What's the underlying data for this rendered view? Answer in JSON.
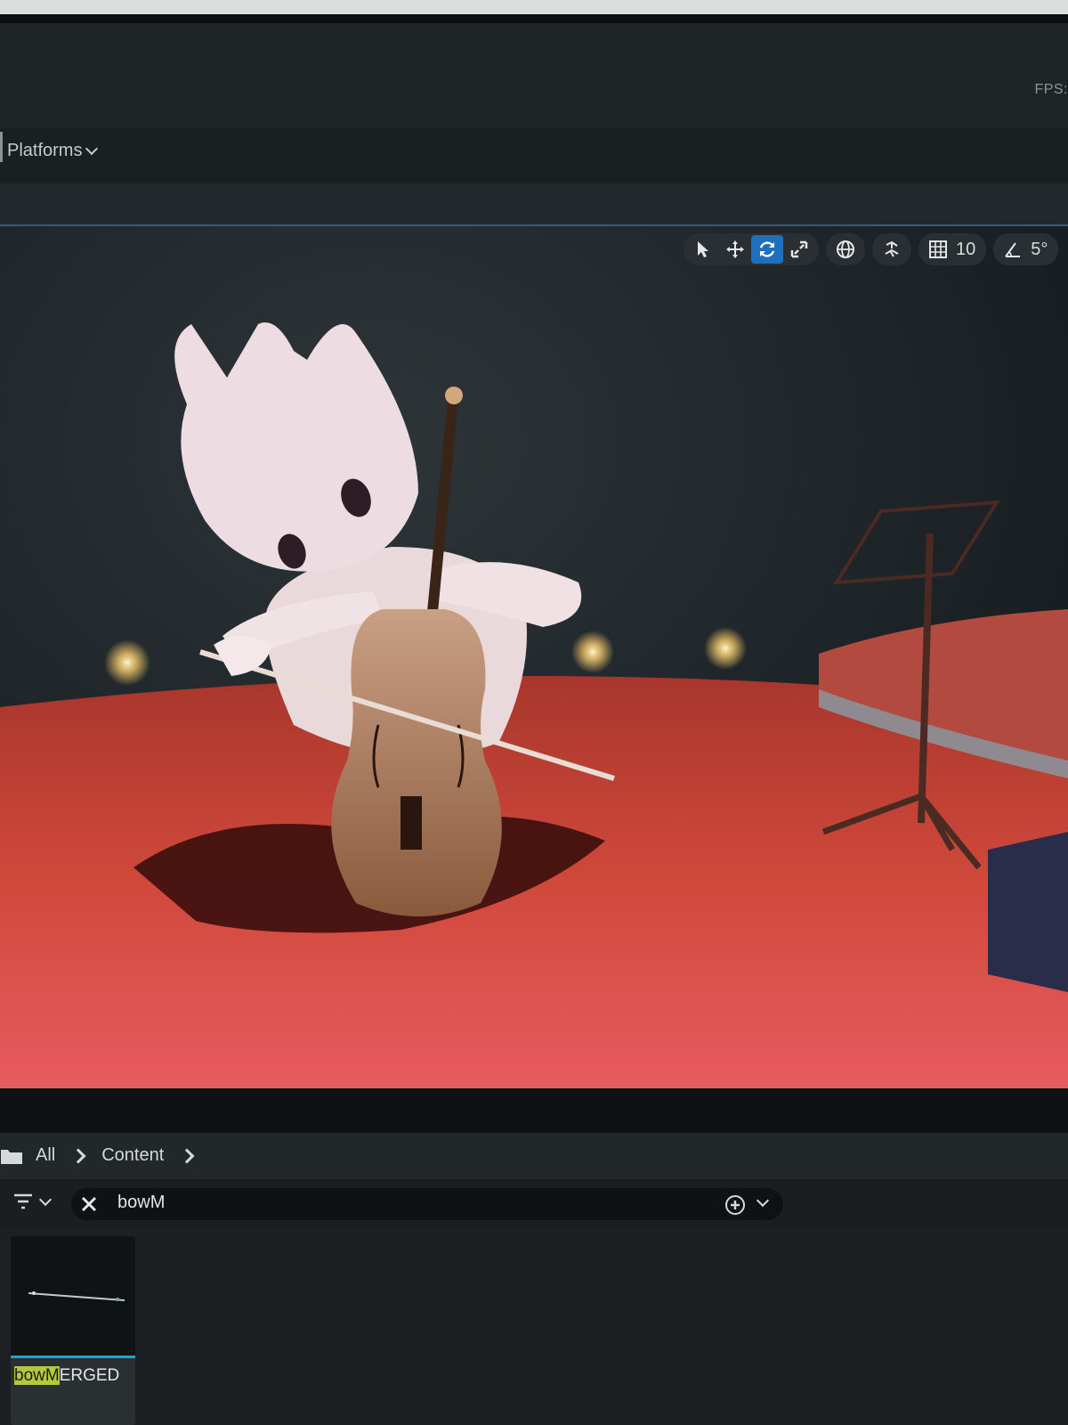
{
  "top_bar": {
    "fps_label": "FPS: "
  },
  "platforms": {
    "label": "Platforms"
  },
  "viewport_toolbar": {
    "tools": [
      {
        "icon": "select-arrow-icon",
        "active": false
      },
      {
        "icon": "translate-icon",
        "active": false
      },
      {
        "icon": "rotate-icon",
        "active": true
      },
      {
        "icon": "scale-icon",
        "active": false
      }
    ],
    "world_local_icon": "globe-icon",
    "surface_snapping_icon": "surface-snap-icon",
    "grid_snap": {
      "icon": "grid-icon",
      "value": "10"
    },
    "rotation_snap": {
      "icon": "angle-icon",
      "value": "5°"
    }
  },
  "content_browser": {
    "breadcrumb": {
      "root": "All",
      "items": [
        "Content"
      ]
    },
    "search": {
      "value": "bowM"
    },
    "assets": [
      {
        "name_highlight": "bowM",
        "name_rest": "ERGED"
      }
    ]
  },
  "colors": {
    "accent": "#1f6fbf",
    "highlight": "#b3c93a",
    "asset_strip": "#1fa6c9",
    "stage_floor": "#c94a3a"
  }
}
